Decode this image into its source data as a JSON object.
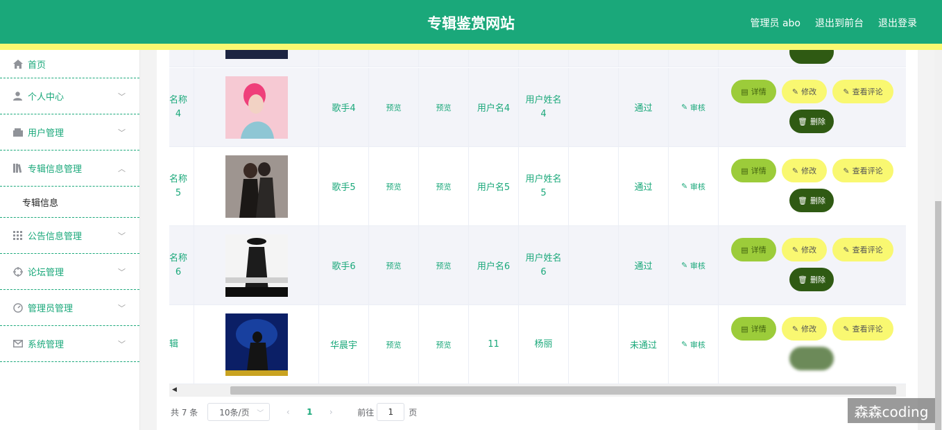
{
  "header": {
    "title": "专辑鉴赏网站",
    "admin_label": "管理员 abo",
    "front_label": "退出到前台",
    "logout_label": "退出登录"
  },
  "sidebar": {
    "items": [
      {
        "label": "首页",
        "icon": "home-icon"
      },
      {
        "label": "个人中心",
        "icon": "user-icon"
      },
      {
        "label": "用户管理",
        "icon": "wallet-icon"
      },
      {
        "label": "专辑信息管理",
        "icon": "library-icon"
      },
      {
        "label": "公告信息管理",
        "icon": "grid-icon"
      },
      {
        "label": "论坛管理",
        "icon": "target-icon"
      },
      {
        "label": "管理员管理",
        "icon": "gauge-icon"
      },
      {
        "label": "系统管理",
        "icon": "mail-icon"
      }
    ],
    "sub_items": [
      {
        "label": "专辑信息"
      }
    ]
  },
  "table": {
    "rows": [
      {
        "name": "名称\n4",
        "singer": "歌手4",
        "preview1": "预览",
        "preview2": "预览",
        "username": "用户名4",
        "realname": "用户姓名\n4",
        "status": "通过",
        "audit": "审核"
      },
      {
        "name": "名称\n5",
        "singer": "歌手5",
        "preview1": "预览",
        "preview2": "预览",
        "username": "用户名5",
        "realname": "用户姓名\n5",
        "status": "通过",
        "audit": "审核"
      },
      {
        "name": "名称\n6",
        "singer": "歌手6",
        "preview1": "预览",
        "preview2": "预览",
        "username": "用户名6",
        "realname": "用户姓名\n6",
        "status": "通过",
        "audit": "审核"
      },
      {
        "name": "辑",
        "singer": "华晨宇",
        "preview1": "预览",
        "preview2": "预览",
        "username": "11",
        "realname": "杨丽",
        "status": "未通过",
        "audit": "审核"
      }
    ],
    "ops": {
      "detail": "详情",
      "edit": "修改",
      "comment": "查看评论",
      "delete": "删除"
    }
  },
  "pagination": {
    "total": "共 7 条",
    "page_size": "10条/页",
    "current_page": "1",
    "goto_label": "前往",
    "goto_value": "1",
    "page_suffix": "页"
  },
  "watermark": "森森coding"
}
